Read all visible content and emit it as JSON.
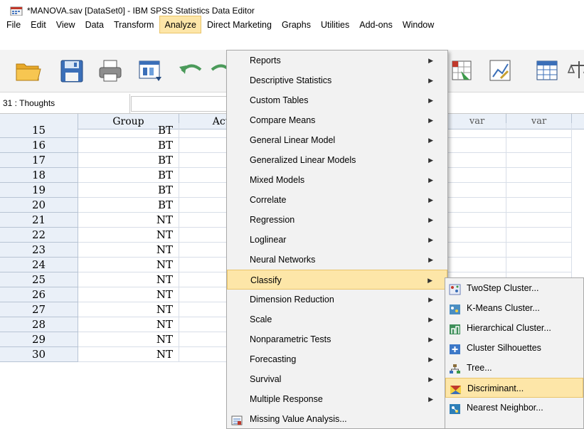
{
  "window": {
    "title": "*MANOVA.sav [DataSet0] - IBM SPSS Statistics Data Editor"
  },
  "menubar": [
    {
      "label": "File",
      "name": "menu-file"
    },
    {
      "label": "Edit",
      "name": "menu-edit"
    },
    {
      "label": "View",
      "name": "menu-view"
    },
    {
      "label": "Data",
      "name": "menu-data"
    },
    {
      "label": "Transform",
      "name": "menu-transform"
    },
    {
      "label": "Analyze",
      "name": "menu-analyze"
    },
    {
      "label": "Direct Marketing",
      "name": "menu-direct-marketing"
    },
    {
      "label": "Graphs",
      "name": "menu-graphs"
    },
    {
      "label": "Utilities",
      "name": "menu-utilities"
    },
    {
      "label": "Add-ons",
      "name": "menu-add-ons"
    },
    {
      "label": "Window",
      "name": "menu-window"
    }
  ],
  "toolbar_icons": [
    "open-icon",
    "save-icon",
    "print-icon",
    "dialog-recall-icon",
    "undo-icon",
    "redo-icon",
    "pivot-icon",
    "chart-builder-icon",
    "table-icon",
    "scale-icon"
  ],
  "cell_editor": {
    "reference": "31 : Thoughts",
    "value": ""
  },
  "grid": {
    "columns": [
      "Group",
      "Act",
      "var",
      "var"
    ],
    "rows": [
      {
        "num": "15",
        "group": "BT"
      },
      {
        "num": "16",
        "group": "BT"
      },
      {
        "num": "17",
        "group": "BT"
      },
      {
        "num": "18",
        "group": "BT"
      },
      {
        "num": "19",
        "group": "BT"
      },
      {
        "num": "20",
        "group": "BT"
      },
      {
        "num": "21",
        "group": "NT"
      },
      {
        "num": "22",
        "group": "NT"
      },
      {
        "num": "23",
        "group": "NT"
      },
      {
        "num": "24",
        "group": "NT"
      },
      {
        "num": "25",
        "group": "NT"
      },
      {
        "num": "26",
        "group": "NT"
      },
      {
        "num": "27",
        "group": "NT"
      },
      {
        "num": "28",
        "group": "NT"
      },
      {
        "num": "29",
        "group": "NT"
      },
      {
        "num": "30",
        "group": "NT"
      }
    ]
  },
  "analyze_menu": {
    "items": [
      {
        "label": "Reports",
        "submenu": true
      },
      {
        "label": "Descriptive Statistics",
        "submenu": true
      },
      {
        "label": "Custom Tables",
        "submenu": true
      },
      {
        "label": "Compare Means",
        "submenu": true
      },
      {
        "label": "General Linear Model",
        "submenu": true
      },
      {
        "label": "Generalized Linear Models",
        "submenu": true
      },
      {
        "label": "Mixed Models",
        "submenu": true
      },
      {
        "label": "Correlate",
        "submenu": true
      },
      {
        "label": "Regression",
        "submenu": true
      },
      {
        "label": "Loglinear",
        "submenu": true
      },
      {
        "label": "Neural Networks",
        "submenu": true
      },
      {
        "label": "Classify",
        "submenu": true,
        "highlighted": true
      },
      {
        "label": "Dimension Reduction",
        "submenu": true
      },
      {
        "label": "Scale",
        "submenu": true
      },
      {
        "label": "Nonparametric Tests",
        "submenu": true
      },
      {
        "label": "Forecasting",
        "submenu": true
      },
      {
        "label": "Survival",
        "submenu": true
      },
      {
        "label": "Multiple Response",
        "submenu": true
      },
      {
        "label": "Missing Value Analysis...",
        "submenu": false,
        "icon": "missing-value-icon"
      }
    ]
  },
  "classify_submenu": {
    "items": [
      {
        "label": "TwoStep Cluster...",
        "icon": "twostep-cluster-icon",
        "color": "#6a7fb8"
      },
      {
        "label": "K-Means Cluster...",
        "icon": "kmeans-cluster-icon",
        "color": "#4b8ec2"
      },
      {
        "label": "Hierarchical Cluster...",
        "icon": "hierarchical-cluster-icon",
        "color": "#3f8f5a"
      },
      {
        "label": "Cluster Silhouettes",
        "icon": "cluster-silhouettes-icon",
        "color": "#3c78c8"
      },
      {
        "label": "Tree...",
        "icon": "tree-icon",
        "color": "#8a6d3b"
      },
      {
        "label": "Discriminant...",
        "icon": "discriminant-icon",
        "color": "#c0392b",
        "highlighted": true
      },
      {
        "label": "Nearest Neighbor...",
        "icon": "nearest-neighbor-icon",
        "color": "#2e7fb8"
      }
    ]
  },
  "colors": {
    "highlight": "#fde6a8",
    "highlight_border": "#e9c46a",
    "grid_header": "#eaf0f8"
  }
}
